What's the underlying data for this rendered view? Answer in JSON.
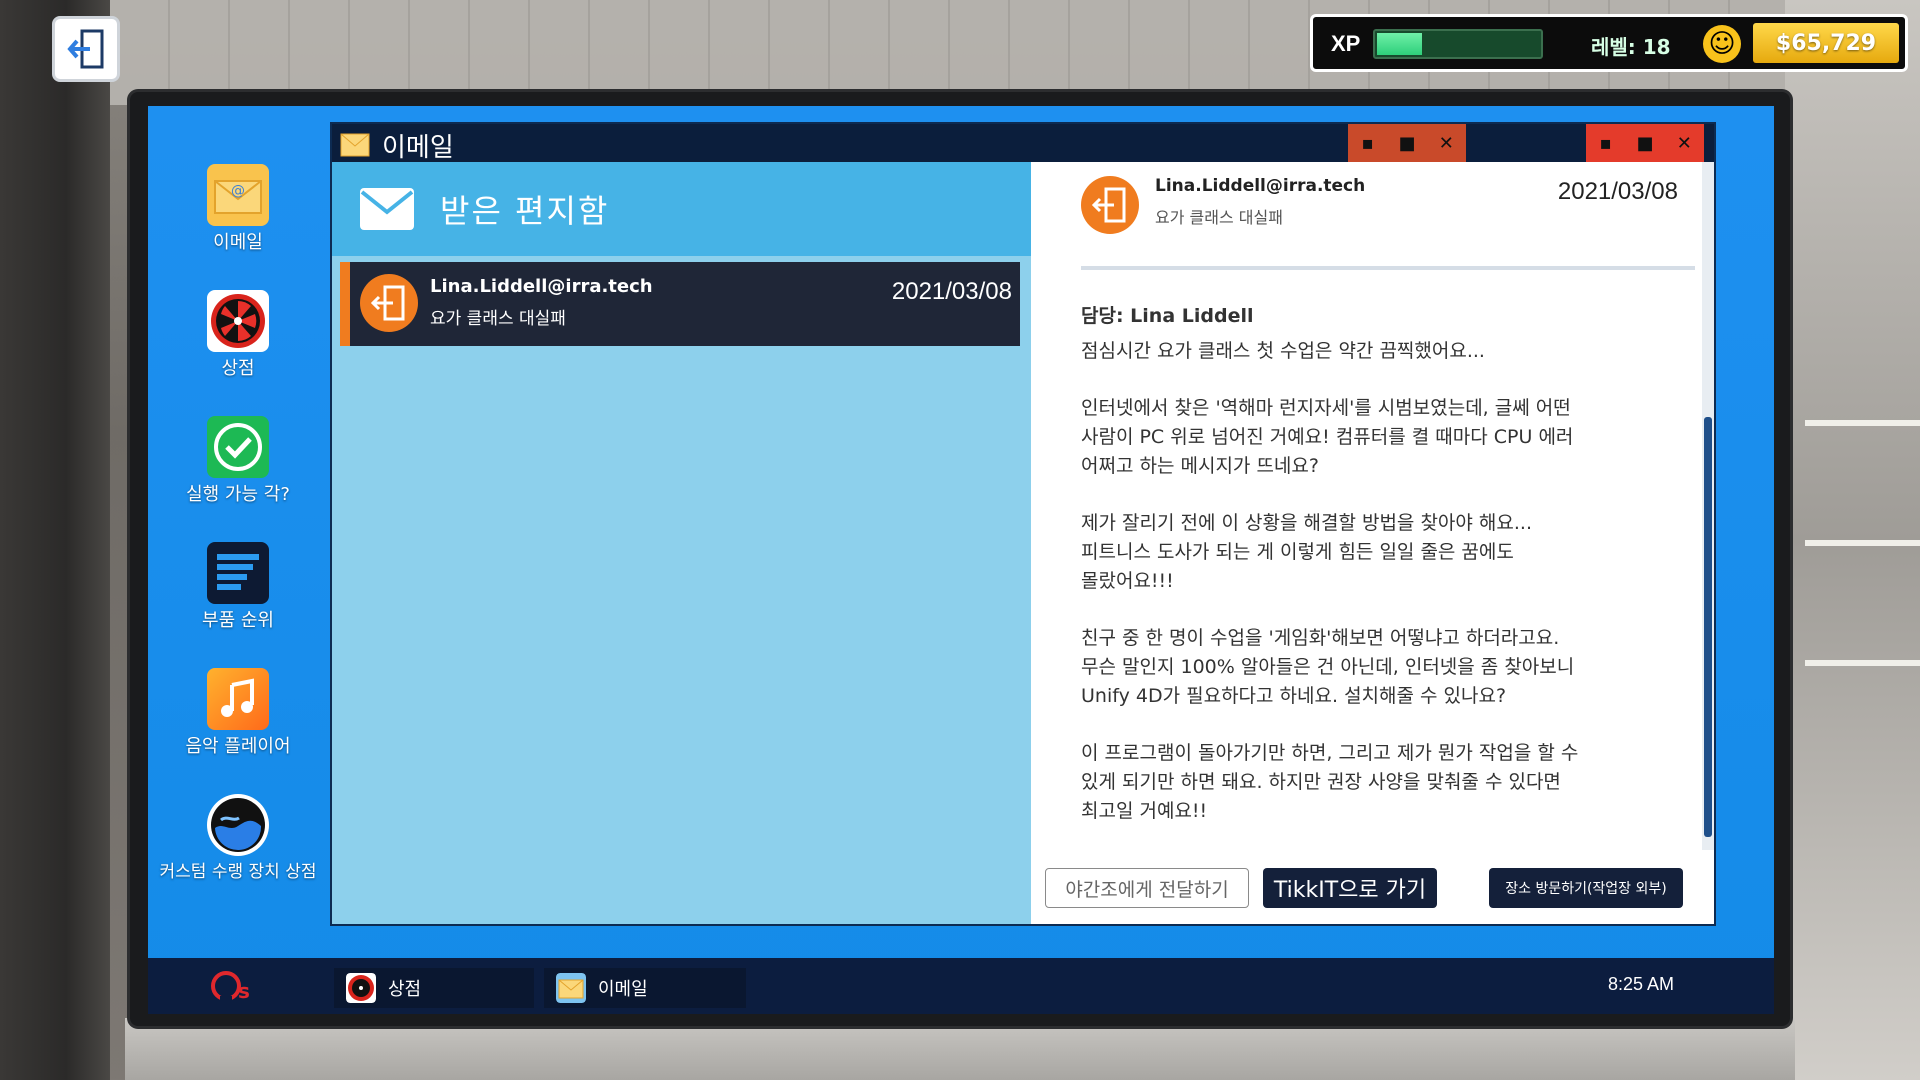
{
  "hud": {
    "xp_label": "XP",
    "xp_progress": 0.28,
    "level_text": "레벨: 18",
    "money": "$65,729"
  },
  "desktop": {
    "icons": [
      {
        "label": "이메일",
        "icon": "email-icon"
      },
      {
        "label": "상점",
        "icon": "shop-icon"
      },
      {
        "label": "실행 가능 각?",
        "icon": "check-icon"
      },
      {
        "label": "부품 순위",
        "icon": "ranking-icon"
      },
      {
        "label": "음악 플레이어",
        "icon": "music-icon"
      },
      {
        "label": "커스텀 수랭 장치 상점",
        "icon": "water-cooling-icon"
      }
    ]
  },
  "taskbar": {
    "items": [
      {
        "label": "상점",
        "icon": "shop-icon"
      },
      {
        "label": "이메일",
        "icon": "email-icon"
      }
    ],
    "clock": "8:25 AM"
  },
  "email_window": {
    "title": "이메일",
    "inbox_title": "받은 편지함",
    "messages": [
      {
        "from": "Lina.Liddell@irra.tech",
        "subject": "요가 클래스 대실패",
        "date": "2021/03/08"
      }
    ],
    "selected": {
      "from": "Lina.Liddell@irra.tech",
      "subject": "요가 클래스 대실패",
      "date": "2021/03/08",
      "sender_line": "담당: Lina Liddell",
      "paragraphs": [
        "점심시간 요가 클래스 첫 수업은 약간 끔찍했어요...",
        "인터넷에서 찾은 '역해마 런지자세'를 시범보였는데, 글쎄 어떤\n사람이 PC 위로 넘어진 거예요! 컴퓨터를 켤 때마다 CPU 에러\n어쩌고 하는 메시지가 뜨네요?",
        "제가 잘리기 전에 이 상황을 해결할 방법을 찾아야 해요...\n피트니스 도사가 되는 게 이렇게 힘든 일일 줄은 꿈에도\n몰랐어요!!!",
        "친구 중 한 명이 수업을 '게임화'해보면 어떻냐고 하더라고요.\n무슨 말인지 100% 알아들은 건 아닌데, 인터넷을 좀 찾아보니\nUnify 4D가 필요하다고 하네요. 설치해줄 수 있나요?",
        "이 프로그램이 돌아가기만 하면, 그리고 제가 뭔가 작업을 할 수\n있게 되기만 하면 돼요. 하지만 권장 사양을 맞춰줄 수 있다면\n최고일 거예요!!"
      ]
    },
    "buttons": {
      "forward": "야간조에게 전달하기",
      "tikkit": "TikkIT으로 가기",
      "visit": "장소 방문하기(작업장 외부)"
    }
  }
}
